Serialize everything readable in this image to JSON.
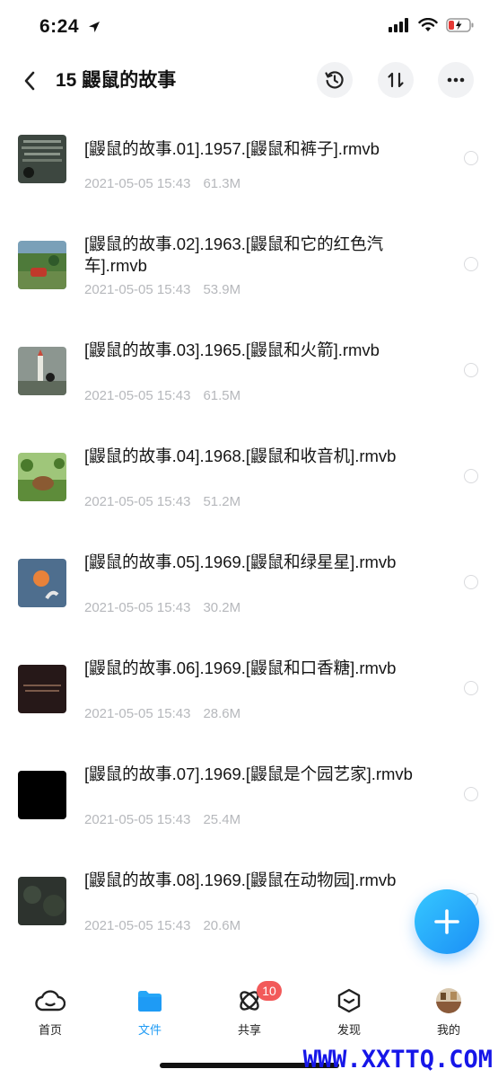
{
  "status": {
    "time": "6:24"
  },
  "header": {
    "title": "15 鼹鼠的故事"
  },
  "files": [
    {
      "name": "[鼹鼠的故事.01].1957.[鼹鼠和裤子].rmvb",
      "date": "2021-05-05 15:43",
      "size": "61.3M",
      "thumb_color": "#3d4740"
    },
    {
      "name": "[鼹鼠的故事.02].1963.[鼹鼠和它的红色汽车].rmvb",
      "date": "2021-05-05 15:43",
      "size": "53.9M",
      "thumb_color": "#5d7a45"
    },
    {
      "name": "[鼹鼠的故事.03].1965.[鼹鼠和火箭].rmvb",
      "date": "2021-05-05 15:43",
      "size": "61.5M",
      "thumb_color": "#7f8a80"
    },
    {
      "name": "[鼹鼠的故事.04].1968.[鼹鼠和收音机].rmvb",
      "date": "2021-05-05 15:43",
      "size": "51.2M",
      "thumb_color": "#6f9a4a"
    },
    {
      "name": "[鼹鼠的故事.05].1969.[鼹鼠和绿星星].rmvb",
      "date": "2021-05-05 15:43",
      "size": "30.2M",
      "thumb_color": "#4e6e8e"
    },
    {
      "name": "[鼹鼠的故事.06].1969.[鼹鼠和口香糖].rmvb",
      "date": "2021-05-05 15:43",
      "size": "28.6M",
      "thumb_color": "#261818"
    },
    {
      "name": "[鼹鼠的故事.07].1969.[鼹鼠是个园艺家].rmvb",
      "date": "2021-05-05 15:43",
      "size": "25.4M",
      "thumb_color": "#000000"
    },
    {
      "name": "[鼹鼠的故事.08].1969.[鼹鼠在动物园].rmvb",
      "date": "2021-05-05 15:43",
      "size": "20.6M",
      "thumb_color": "#2d332e"
    }
  ],
  "tabs": [
    {
      "label": "首页",
      "icon": "cloud-home-icon"
    },
    {
      "label": "文件",
      "icon": "folder-icon",
      "active": true
    },
    {
      "label": "共享",
      "icon": "share-orbit-icon",
      "badge": "10"
    },
    {
      "label": "发现",
      "icon": "discover-box-icon"
    },
    {
      "label": "我的",
      "icon": "avatar"
    }
  ],
  "watermark": "WWW.XXTTQ.COM",
  "colors": {
    "accent": "#1e9bf5",
    "badge": "#f25a5a",
    "meta": "#b6b8bc"
  }
}
